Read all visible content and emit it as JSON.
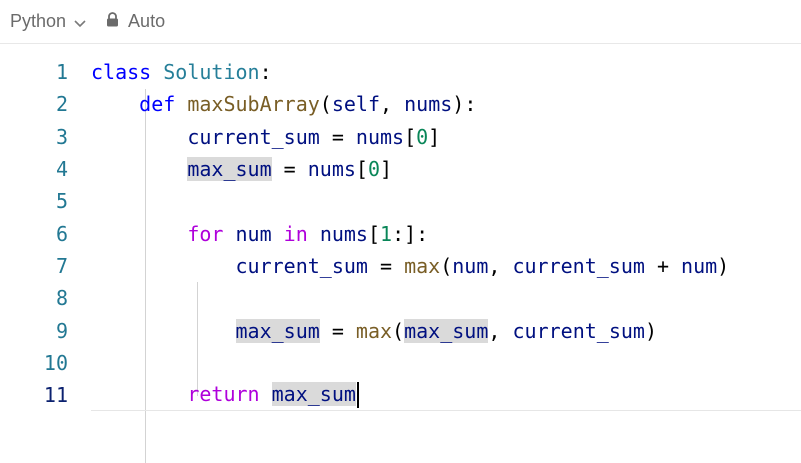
{
  "toolbar": {
    "language": "Python",
    "mode": "Auto",
    "icons": [
      "chevron-down-icon",
      "lock-icon"
    ]
  },
  "editor": {
    "current_line": 11,
    "lines": [
      {
        "number": "1",
        "text": "class Solution:"
      },
      {
        "number": "2",
        "text": "    def maxSubArray(self, nums):"
      },
      {
        "number": "3",
        "text": "        current_sum = nums[0]"
      },
      {
        "number": "4",
        "text": "        max_sum = nums[0]"
      },
      {
        "number": "5",
        "text": ""
      },
      {
        "number": "6",
        "text": "        for num in nums[1:]:"
      },
      {
        "number": "7",
        "text": "            current_sum = max(num, current_sum + num)"
      },
      {
        "number": "8",
        "text": ""
      },
      {
        "number": "9",
        "text": "            max_sum = max(max_sum, current_sum)"
      },
      {
        "number": "10",
        "text": ""
      },
      {
        "number": "11",
        "text": "        return max_sum"
      }
    ]
  },
  "colors": {
    "keyword_blue": "#0000ff",
    "keyword_purple": "#af00db",
    "class_name": "#267f99",
    "function_name": "#795e26",
    "variable": "#001080",
    "number": "#098658",
    "line_number": "#227893",
    "word_highlight": "#dadada"
  }
}
